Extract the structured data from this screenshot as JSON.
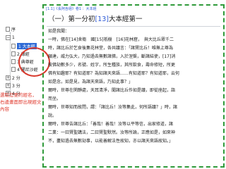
{
  "tree": {
    "root_label": "序",
    "items": [
      {
        "label": "1",
        "expanded": true
      },
      {
        "label": "1 大本經",
        "selected": true
      },
      {
        "label": "2 緣經"
      },
      {
        "label": "3 典尊經"
      },
      {
        "label": "4 闍尼沙經"
      },
      {
        "label": "2 分"
      },
      {
        "label": "3 分"
      },
      {
        "label": "4 分"
      }
    ]
  },
  "callout": {
    "line1": "選取您要的經名，",
    "line2": "右邊畫面即出現經文內容"
  },
  "document": {
    "header": "[1.1]《長阿含經》卷1 ：大本經",
    "title_prefix": "（一）第一分初",
    "title_ref": "[13]",
    "title_suffix": "大本經第一",
    "paragraphs": [
      "如是我聞：",
      "一時，佛在[14]舍衛　國[15]祇樹　[16]花林窟，　與大比丘眾千二",
      "時，諸比丘於乞食後集花林堂，各共議言：「諸賢比丘！唯無上尊為",
      "頗達，威力弘大，乃知過去無數諸佛，入於涅槃，斷諸結使，[17]消",
      "彼佛劫數多少，名號、姓字，所生種族，其所飲食，壽命修短，所更",
      "佛有知趣耶？有知道耶？為知諸天來語……有知道耶？有知道耶，云何",
      "如是念，如是見，為諸天來語，乃知此事？」",
      "爾時，世尊在閑靜處，天耳清淨，聞諸比丘作如是議，即從座起，詣",
      "而坐。",
      "爾時，世尊知而故問，謂：「諸比丘！汝等集此，何所語議？」時，諸",
      "說。",
      "爾時，世尊告諸比丘：「善哉！善哉！汝等以平等信，出家修道，諸",
      "二業：一曰賢聖講法，二曰賢聖默然。汝等所論，正應如是，如來神",
      "不，盡知過去無數劫事，以能善解法性故知，亦以諸天來語故知。」"
    ]
  }
}
